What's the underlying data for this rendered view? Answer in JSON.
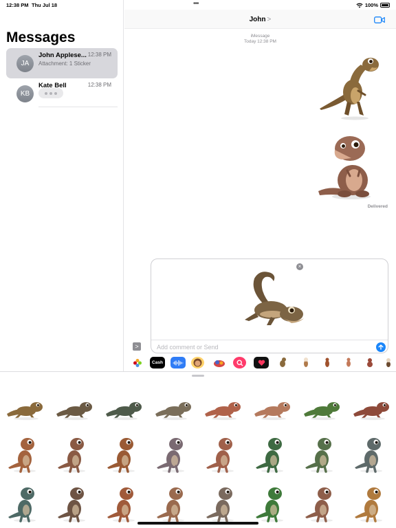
{
  "status": {
    "time": "12:38 PM",
    "date": "Thu Jul 18",
    "battery": "100%"
  },
  "sidebar": {
    "title": "Messages",
    "conversations": [
      {
        "initials": "JA",
        "name": "John Applese...",
        "time": "12:38 PM",
        "preview": "Attachment: 1 Sticker"
      },
      {
        "initials": "KB",
        "name": "Kate Bell",
        "time": "12:38 PM",
        "preview": ""
      }
    ]
  },
  "chat": {
    "title": "John",
    "chevron": ">",
    "service": "iMessage",
    "timestamp": "Today 12:38 PM",
    "delivered": "Delivered",
    "compose_placeholder": "Add comment or Send",
    "apps_toggle": ">"
  },
  "app_strip": [
    {
      "name": "photos-app",
      "label": "",
      "color": "#ffffff"
    },
    {
      "name": "apple-cash-app",
      "label": "Cash",
      "color": "#000000"
    },
    {
      "name": "audio-message-app",
      "label": "",
      "color": "#2f7cf6"
    },
    {
      "name": "memoji-app",
      "label": "",
      "color": "#ffd26a"
    },
    {
      "name": "digital-touch-app",
      "label": "",
      "color": "#f2f2f2"
    },
    {
      "name": "image-search-app",
      "label": "",
      "color": "#ff3b6b"
    },
    {
      "name": "fitness-app",
      "label": "",
      "color": "#111111"
    }
  ],
  "colors": {
    "accent": "#1b86f9",
    "selected_row": "#d7d7dc"
  }
}
